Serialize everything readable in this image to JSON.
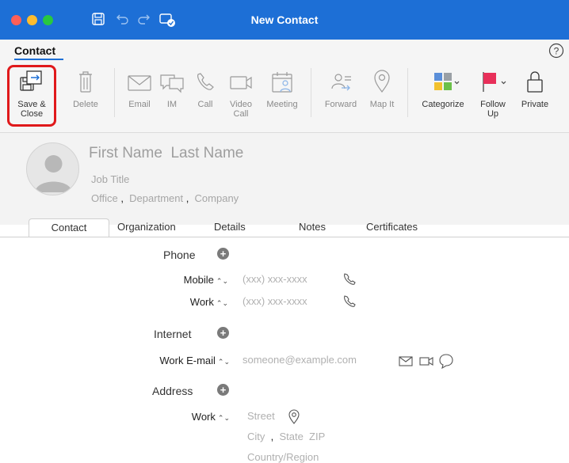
{
  "window": {
    "title": "New Contact"
  },
  "ribbon": {
    "tab": "Contact",
    "buttons": {
      "save_close": "Save & Close",
      "delete": "Delete",
      "email": "Email",
      "im": "IM",
      "call": "Call",
      "video_call": "Video Call",
      "meeting": "Meeting",
      "forward": "Forward",
      "map_it": "Map It",
      "categorize": "Categorize",
      "follow_up": "Follow Up",
      "private": "Private"
    }
  },
  "header": {
    "first_name": "First Name",
    "last_name": "Last Name",
    "job_title": "Job Title",
    "office": "Office",
    "department": "Department",
    "company": "Company"
  },
  "tabs": [
    "Contact",
    "Organization",
    "Details",
    "Notes",
    "Certificates"
  ],
  "phone": {
    "section": "Phone",
    "rows": [
      {
        "label": "Mobile",
        "placeholder": "(xxx) xxx-xxxx"
      },
      {
        "label": "Work",
        "placeholder": "(xxx) xxx-xxxx"
      }
    ]
  },
  "internet": {
    "section": "Internet",
    "label": "Work E-mail",
    "placeholder": "someone@example.com"
  },
  "address": {
    "section": "Address",
    "label": "Work",
    "street": "Street",
    "city": "City",
    "state": "State",
    "zip": "ZIP",
    "country": "Country/Region"
  },
  "colors": {
    "accent": "#1d6fd6",
    "highlight": "#e0191b",
    "flag": "#e8305a"
  }
}
